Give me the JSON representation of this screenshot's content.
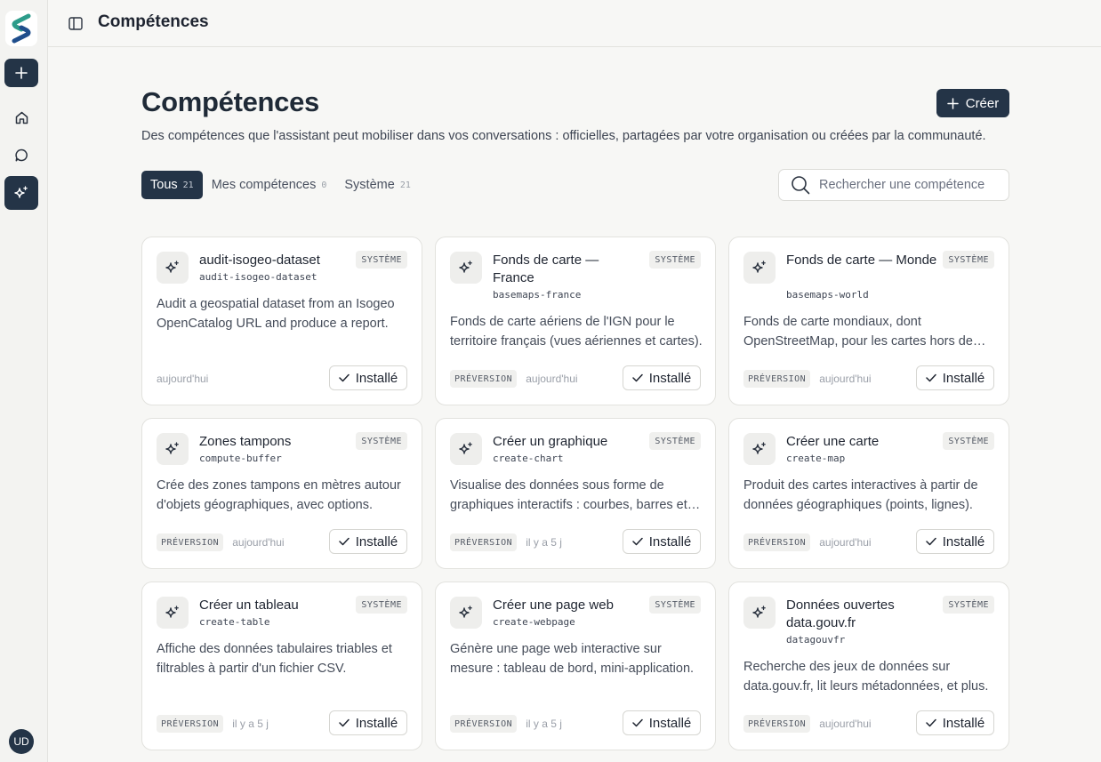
{
  "app": {
    "user_initials": "UD"
  },
  "header": {
    "title": "Compétences"
  },
  "page": {
    "title": "Compétences",
    "create_label": "Créer",
    "description": "Des compétences que l'assistant peut mobiliser dans vos conversations : officielles, partagées par votre organisation ou créées par la communauté.",
    "search_placeholder": "Rechercher une compétence"
  },
  "tabs": [
    {
      "label": "Tous",
      "count": "21"
    },
    {
      "label": "Mes compétences",
      "count": "0"
    },
    {
      "label": "Système",
      "count": "21"
    }
  ],
  "colors": {
    "accent": "#243447",
    "background": "#f7f7f5",
    "card": "#ffffff"
  },
  "icons": {
    "logo": "logo-icon",
    "new": "plus-icon",
    "home": "home-icon",
    "chat": "chat-icon",
    "skills": "sparkles-icon",
    "toggle": "sidebar-toggle-icon",
    "search": "search-icon",
    "check": "check-icon"
  },
  "cards": [
    {
      "title": "audit-isogeo-dataset",
      "slug": "audit-isogeo-dataset",
      "badge": "SYSTÈME",
      "description": "Audit a geospatial dataset from an Isogeo OpenCatalog URL and produce a report.",
      "preview": "",
      "date": "aujourd'hui",
      "install_label": "Installé"
    },
    {
      "title": "Fonds de carte — France",
      "slug": "basemaps-france",
      "badge": "SYSTÈME",
      "description": "Fonds de carte aériens de l'IGN pour le territoire français (vues aériennes et cartes).",
      "preview": "PRÉVERSION",
      "date": "aujourd'hui",
      "install_label": "Installé"
    },
    {
      "title": "Fonds de carte — Monde",
      "slug": "basemaps-world",
      "badge": "SYSTÈME",
      "description": "Fonds de carte mondiaux, dont OpenStreetMap, pour les cartes hors de France.",
      "preview": "PRÉVERSION",
      "date": "aujourd'hui",
      "install_label": "Installé"
    },
    {
      "title": "Zones tampons",
      "slug": "compute-buffer",
      "badge": "SYSTÈME",
      "description": "Crée des zones tampons en mètres autour d'objets géographiques, avec options.",
      "preview": "PRÉVERSION",
      "date": "aujourd'hui",
      "install_label": "Installé"
    },
    {
      "title": "Créer un graphique",
      "slug": "create-chart",
      "badge": "SYSTÈME",
      "description": "Visualise des données sous forme de graphiques interactifs : courbes, barres et plus.",
      "preview": "PRÉVERSION",
      "date": "il y a 5 j",
      "install_label": "Installé"
    },
    {
      "title": "Créer une carte",
      "slug": "create-map",
      "badge": "SYSTÈME",
      "description": "Produit des cartes interactives à partir de données géographiques (points, lignes).",
      "preview": "PRÉVERSION",
      "date": "aujourd'hui",
      "install_label": "Installé"
    },
    {
      "title": "Créer un tableau",
      "slug": "create-table",
      "badge": "SYSTÈME",
      "description": "Affiche des données tabulaires triables et filtrables à partir d'un fichier CSV.",
      "preview": "PRÉVERSION",
      "date": "il y a 5 j",
      "install_label": "Installé"
    },
    {
      "title": "Créer une page web",
      "slug": "create-webpage",
      "badge": "SYSTÈME",
      "description": "Génère une page web interactive sur mesure : tableau de bord, mini-application.",
      "preview": "PRÉVERSION",
      "date": "il y a 5 j",
      "install_label": "Installé"
    },
    {
      "title": "Données ouvertes data.gouv.fr",
      "slug": "datagouvfr",
      "badge": "SYSTÈME",
      "description": "Recherche des jeux de données sur data.gouv.fr, lit leurs métadonnées, et plus.",
      "preview": "PRÉVERSION",
      "date": "aujourd'hui",
      "install_label": "Installé"
    }
  ]
}
